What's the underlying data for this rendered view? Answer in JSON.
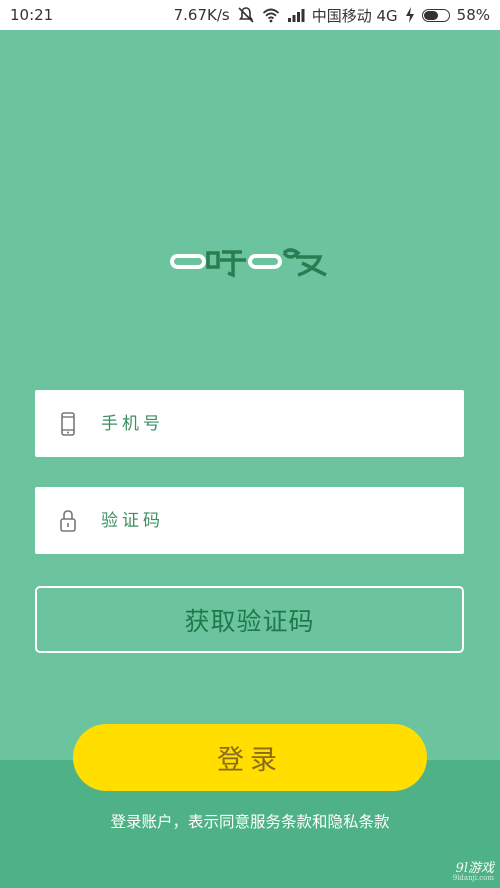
{
  "status_bar": {
    "time": "10:21",
    "speed": "7.67K/s",
    "carrier": "中国移动 4G",
    "battery_percent": "58%",
    "battery_level": 0.58
  },
  "colors": {
    "background": "#6bc49d",
    "bottom_band": "#4fb286",
    "login_button": "#ffde00",
    "accent_text": "#1e7a4a"
  },
  "form": {
    "phone_placeholder": "手机号",
    "code_placeholder": "验证码",
    "get_code_label": "获取验证码",
    "login_label": "登录"
  },
  "terms_text": "登录账户，表示同意服务条款和隐私条款",
  "watermark": {
    "brand": "9l游戏",
    "url": "9ldanji.com"
  }
}
